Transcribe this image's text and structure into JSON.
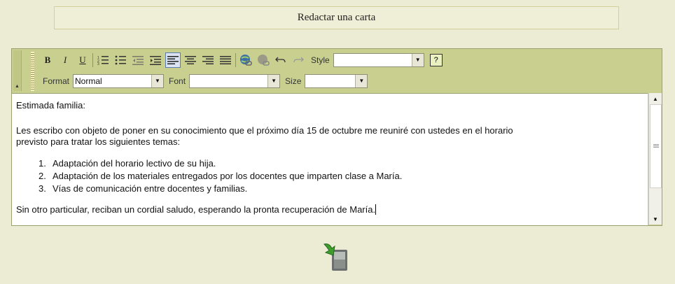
{
  "title": "Redactar una carta",
  "toolbar": {
    "bold_label": "B",
    "italic_label": "I",
    "underline_label": "U",
    "style_label": "Style",
    "style_value": "",
    "help_label": "?",
    "format_label": "Format",
    "format_value": "Normal",
    "font_label": "Font",
    "font_value": "",
    "size_label": "Size",
    "size_value": ""
  },
  "letter": {
    "greeting": "Estimada familia:",
    "intro_line1": "Les escribo con objeto de poner en su conocimiento que el próximo día 15 de octubre me reuniré con ustedes en el horario",
    "intro_line2": "previsto para tratar los siguientes temas:",
    "items": [
      {
        "num": "1.",
        "text": "Adaptación del horario lectivo de su hija."
      },
      {
        "num": "2.",
        "text": "Adaptación de los materiales entregados por los docentes que imparten clase a María."
      },
      {
        "num": "3.",
        "text": "Vías de comunicación entre docentes y familias."
      }
    ],
    "closing": "Sin otro particular, reciban un cordial saludo, esperando la pronta recuperación de María."
  },
  "icons": {
    "save": "save-icon"
  }
}
